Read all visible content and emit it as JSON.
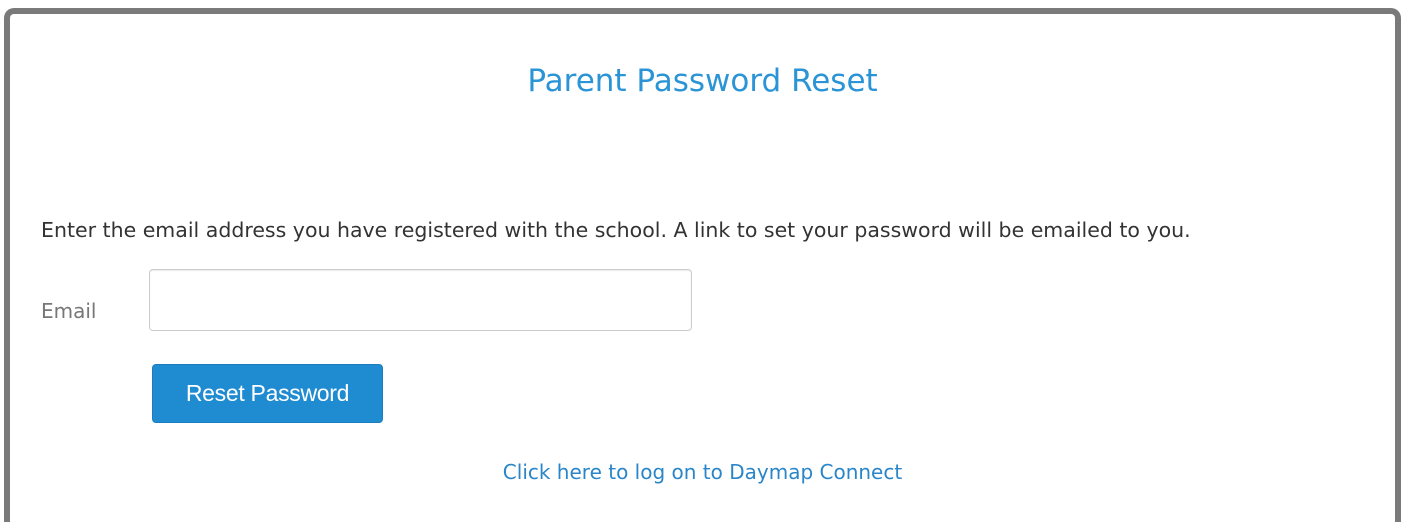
{
  "page": {
    "title": "Parent Password Reset",
    "instructions": "Enter the email address you have registered with the school. A link to set your password will be emailed to you."
  },
  "form": {
    "email_label": "Email",
    "email_value": "",
    "email_placeholder": "",
    "submit_label": "Reset Password"
  },
  "footer": {
    "logon_link_text": "Click here to log on to Daymap Connect"
  },
  "colors": {
    "accent": "#2a94d6",
    "button": "#1f8bd1",
    "frame_border": "#7a7a7a"
  }
}
